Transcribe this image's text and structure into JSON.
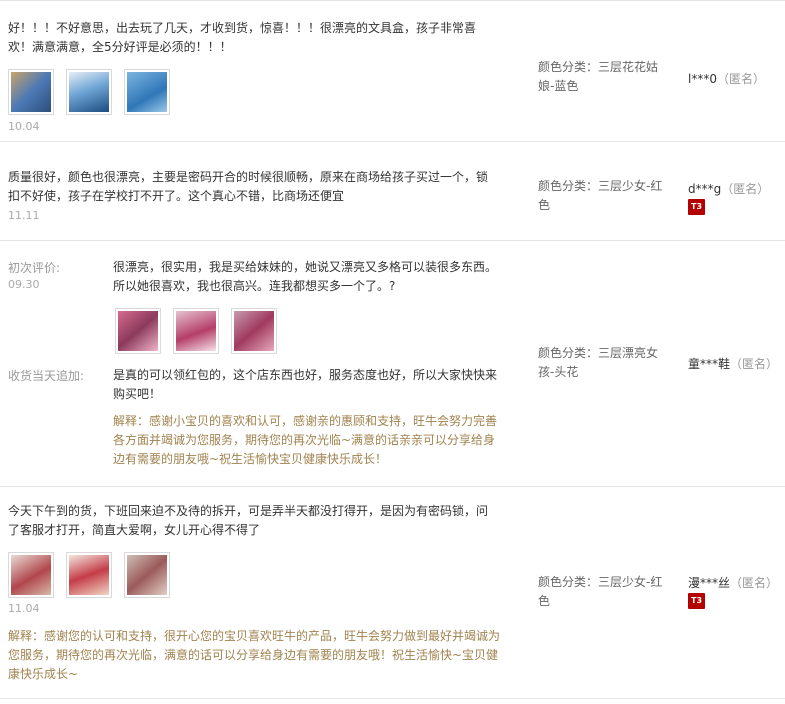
{
  "reviews": [
    {
      "text": "好！！！不好意思，出去玩了几天，才收到货，惊喜！！！很漂亮的文具盒，孩子非常喜欢！满意满意，全5分好评是必须的！！！",
      "date": "10.04",
      "spec": "颜色分类：三层花花姑娘-蓝色",
      "user": "l***0",
      "anon": "（匿名）"
    },
    {
      "text": "质量很好，颜色也很漂亮，主要是密码开合的时候很顺畅，原来在商场给孩子买过一个，锁扣不好使，孩子在学校打不开了。这个真心不错，比商场还便宜",
      "date": "11.11",
      "spec": "颜色分类：三层少女-红色",
      "user": "d***g",
      "anon": "（匿名）",
      "badge": "T3"
    },
    {
      "initial_label": "初次评价:",
      "initial_date": "09.30",
      "text": "很漂亮，很实用，我是买给妹妹的，她说又漂亮又多格可以装很多东西。所以她很喜欢，我也很高兴。连我都想买多一个了。?",
      "followup_label": "收货当天追加:",
      "followup_text": "是真的可以领红包的，这个店东西也好，服务态度也好，所以大家快快来购买吧！",
      "reply": "解释：感谢小宝贝的喜欢和认可，感谢亲的惠顾和支持，旺牛会努力完善各方面并竭诚为您服务，期待您的再次光临~满意的话亲亲可以分享给身边有需要的朋友哦~祝生活愉快宝贝健康快乐成长！",
      "spec": "颜色分类：三层漂亮女孩-头花",
      "user": "童***鞋",
      "anon": "（匿名）"
    },
    {
      "text": "今天下午到的货，下班回来迫不及待的拆开，可是弄半天都没打得开，是因为有密码锁，问了客服才打开，简直大爱啊，女儿开心得不得了",
      "date": "11.04",
      "reply": "解释：感谢您的认可和支持，很开心您的宝贝喜欢旺牛的产品，旺牛会努力做到最好并竭诚为您服务，期待您的再次光临，满意的话可以分享给身边有需要的朋友哦！祝生活愉快~宝贝健康快乐成长~",
      "spec": "颜色分类：三层少女-红色",
      "user": "漫***丝",
      "anon": "（匿名）",
      "badge": "T3"
    }
  ]
}
